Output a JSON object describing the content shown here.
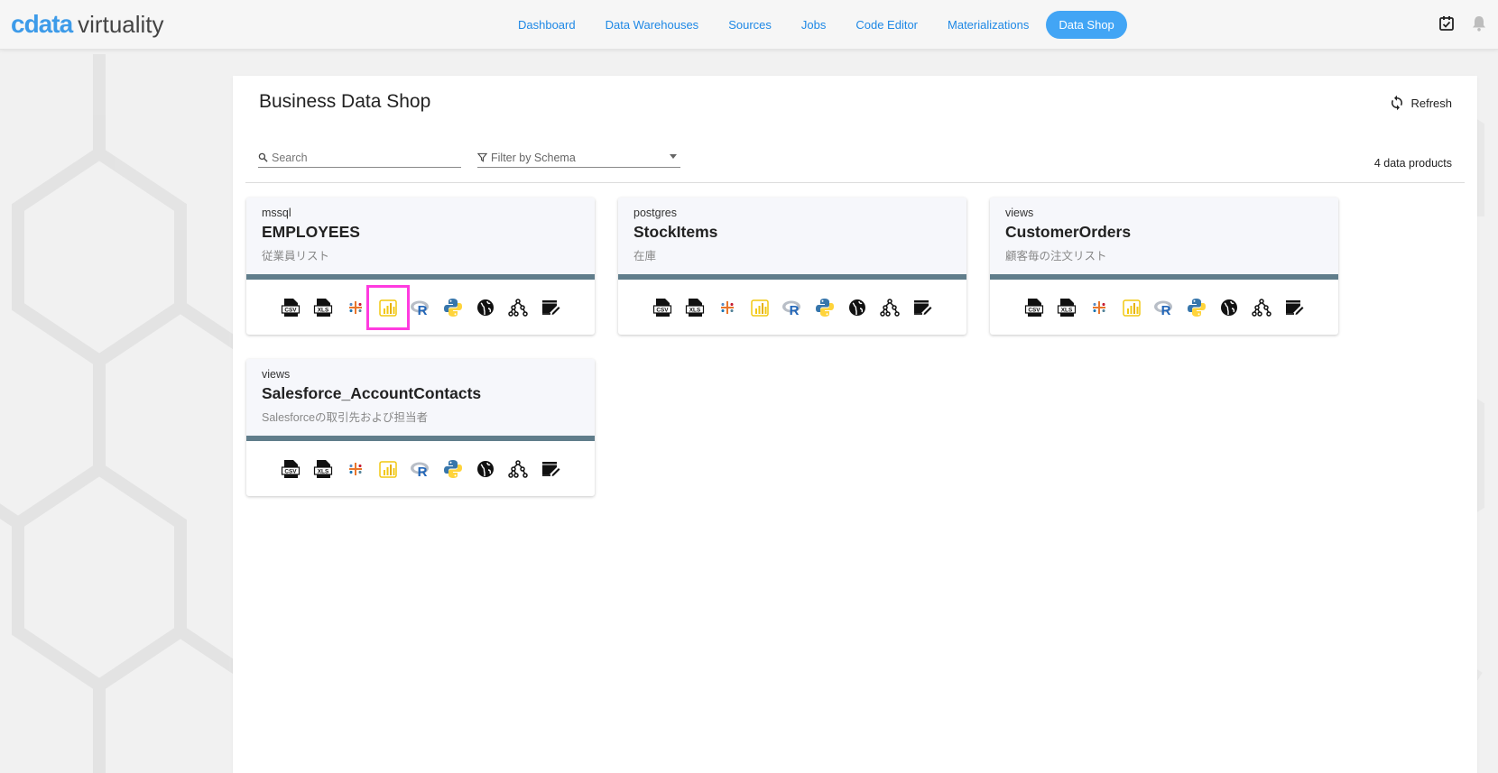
{
  "app": {
    "logo_primary": "cdata",
    "logo_secondary": "virtuality"
  },
  "nav": {
    "items": [
      {
        "label": "Dashboard"
      },
      {
        "label": "Data Warehouses"
      },
      {
        "label": "Sources"
      },
      {
        "label": "Jobs"
      },
      {
        "label": "Code Editor"
      },
      {
        "label": "Materializations"
      },
      {
        "label": "Data Shop",
        "active": true
      }
    ],
    "icons": [
      "tasks-checklist-icon",
      "bell-icon"
    ]
  },
  "page": {
    "title": "Business Data Shop",
    "refresh_label": "Refresh",
    "search_placeholder": "Search",
    "filter_placeholder": "Filter by Schema",
    "count_label": "4 data products"
  },
  "products": [
    {
      "schema": "mssql",
      "name": "EMPLOYEES",
      "description": "従業員リスト"
    },
    {
      "schema": "postgres",
      "name": "StockItems",
      "description": "在庫"
    },
    {
      "schema": "views",
      "name": "CustomerOrders",
      "description": "顧客毎の注文リスト"
    },
    {
      "schema": "views",
      "name": "Salesforce_AccountContacts",
      "description": "Salesforceの取引先および担当者"
    }
  ],
  "tool_icons": {
    "csv": "CSV",
    "xls": "XLS",
    "r": "R"
  },
  "colors": {
    "accent": "#42a5f5",
    "nav_text": "#1e88e5",
    "card_bar": "#607d8b",
    "highlight": "#ff3bdf",
    "powerbi": "#f2c811"
  }
}
